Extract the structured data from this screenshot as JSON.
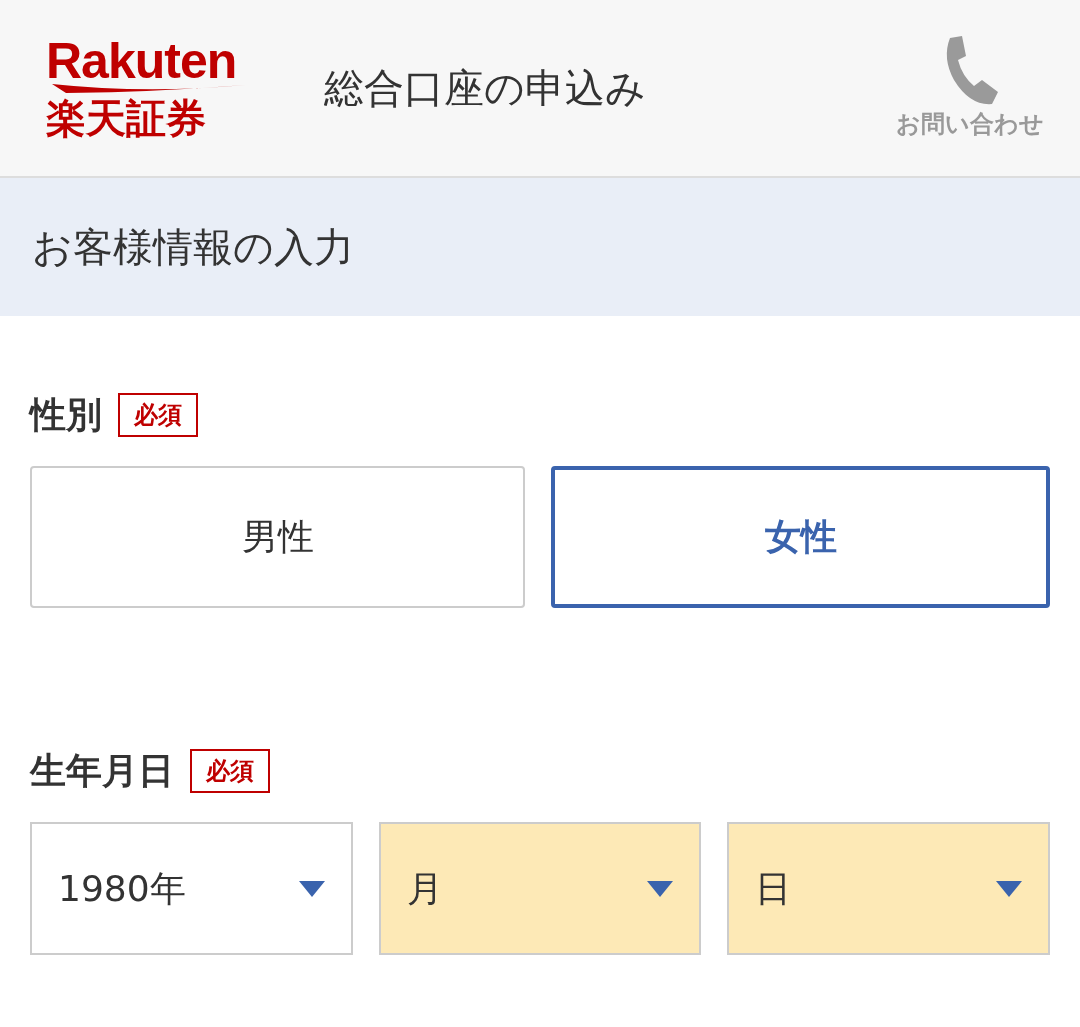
{
  "header": {
    "logo": {
      "brand": "Rakuten",
      "name": "楽天証券"
    },
    "title": "総合口座の申込み",
    "contact": {
      "label": "お問い合わせ"
    }
  },
  "section_title": "お客様情報の入力",
  "fields": [
    {
      "kind": "choice",
      "label": "性別",
      "required": "必須",
      "options": [
        {
          "label": "男性",
          "selected": false
        },
        {
          "label": "女性",
          "selected": true
        }
      ]
    },
    {
      "kind": "date",
      "label": "生年月日",
      "required": "必須",
      "selects": [
        {
          "value": "1980年",
          "empty": false
        },
        {
          "value": "月",
          "empty": true
        },
        {
          "value": "日",
          "empty": true
        }
      ]
    }
  ]
}
